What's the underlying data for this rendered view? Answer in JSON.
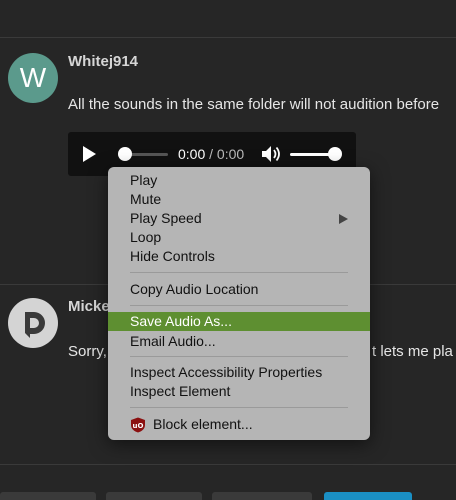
{
  "posts": [
    {
      "avatar_letter": "W",
      "username": "Whitej914",
      "text": "All the sounds in the same folder will not audition before"
    },
    {
      "username": "Micke",
      "text": "Sorry,"
    }
  ],
  "post2_trailing_text": "t lets me pla",
  "audio_player": {
    "time_current": "0:00",
    "time_separator": "/",
    "time_total": "0:00",
    "volume_fraction": 0.85,
    "progress_fraction": 0.0
  },
  "context_menu": {
    "group1": [
      "Play",
      "Mute",
      "Play Speed",
      "Loop",
      "Hide Controls"
    ],
    "group2": [
      "Copy Audio Location"
    ],
    "group3": [
      "Save Audio As...",
      "Email Audio..."
    ],
    "group4": [
      "Inspect Accessibility Properties",
      "Inspect Element"
    ],
    "group5": [
      "Block element..."
    ],
    "highlighted_item": "Save Audio As..."
  },
  "colors": {
    "background": "#262626",
    "avatar_w": "#5b9a8c",
    "highlight": "#5e8f31",
    "menu_bg": "#b5b5b5",
    "accent_button": "#1a8fc4"
  }
}
